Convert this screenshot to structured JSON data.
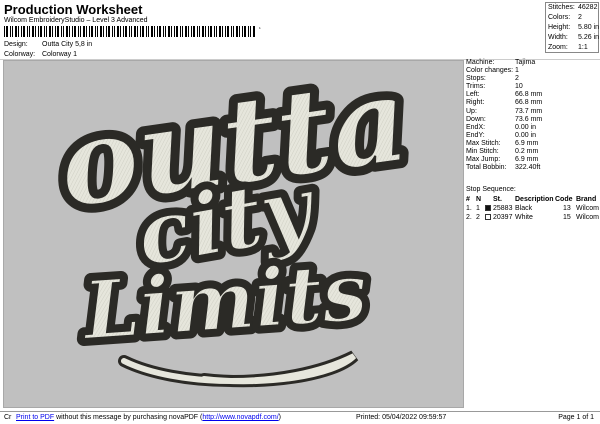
{
  "header": {
    "title": "Production Worksheet",
    "subtitle": "Wilcom EmbroideryStudio – Level 3 Advanced",
    "barcode_suffix": "‘",
    "design_label": "Design:",
    "design_value": "Outta City 5,8 in",
    "colorway_label": "Colorway:",
    "colorway_value": "Colorway 1"
  },
  "stats": [
    {
      "label": "Stitches:",
      "value": "46282"
    },
    {
      "label": "Colors:",
      "value": "2"
    },
    {
      "label": "Height:",
      "value": "5.80 in"
    },
    {
      "label": "Width:",
      "value": "5.26 in"
    },
    {
      "label": "Zoom:",
      "value": "1:1"
    }
  ],
  "properties": [
    {
      "label": "Machine:",
      "value": "Tajima"
    },
    {
      "label": "Color changes:",
      "value": "1"
    },
    {
      "label": "Stops:",
      "value": "2"
    },
    {
      "label": "Trims:",
      "value": "10"
    },
    {
      "label": "Left:",
      "value": "66.8 mm"
    },
    {
      "label": "Right:",
      "value": "66.8 mm"
    },
    {
      "label": "Up:",
      "value": "73.7 mm"
    },
    {
      "label": "Down:",
      "value": "73.6 mm"
    },
    {
      "label": "EndX:",
      "value": "0.00 in"
    },
    {
      "label": "EndY:",
      "value": "0.00 in"
    },
    {
      "label": "Max Stitch:",
      "value": "6.9 mm"
    },
    {
      "label": "Min Stitch:",
      "value": "0.2 mm"
    },
    {
      "label": "Max Jump:",
      "value": "6.9 mm"
    },
    {
      "label": "Total Bobbin:",
      "value": "322.40ft"
    }
  ],
  "stop_sequence": {
    "title": "Stop Sequence:",
    "headers": [
      "#",
      "N",
      "St.",
      "Description",
      "Code",
      "Brand"
    ],
    "rows": [
      {
        "num": "1.",
        "n": "1",
        "color": "#111111",
        "st": "25883",
        "description": "Black",
        "code": "13",
        "brand": "Wilcom"
      },
      {
        "num": "2.",
        "n": "2",
        "color": "#ffffff",
        "st": "20397",
        "description": "White",
        "code": "15",
        "brand": "Wilcom"
      }
    ]
  },
  "design": {
    "line1": "outta",
    "line2": "city",
    "line3": "Limits",
    "thread_dark": "#2b2a26",
    "thread_light": "#e6e6dc",
    "background": "#c0c0c0"
  },
  "footer": {
    "cr": "Cr",
    "link_print": "Print to PDF",
    "message": " without this message by purchasing novaPDF (",
    "link_url": "http://www.novapdf.com/",
    "message_end": ")",
    "printed": "Printed: 05/04/2022 09:59:57",
    "page": "Page 1 of 1"
  }
}
